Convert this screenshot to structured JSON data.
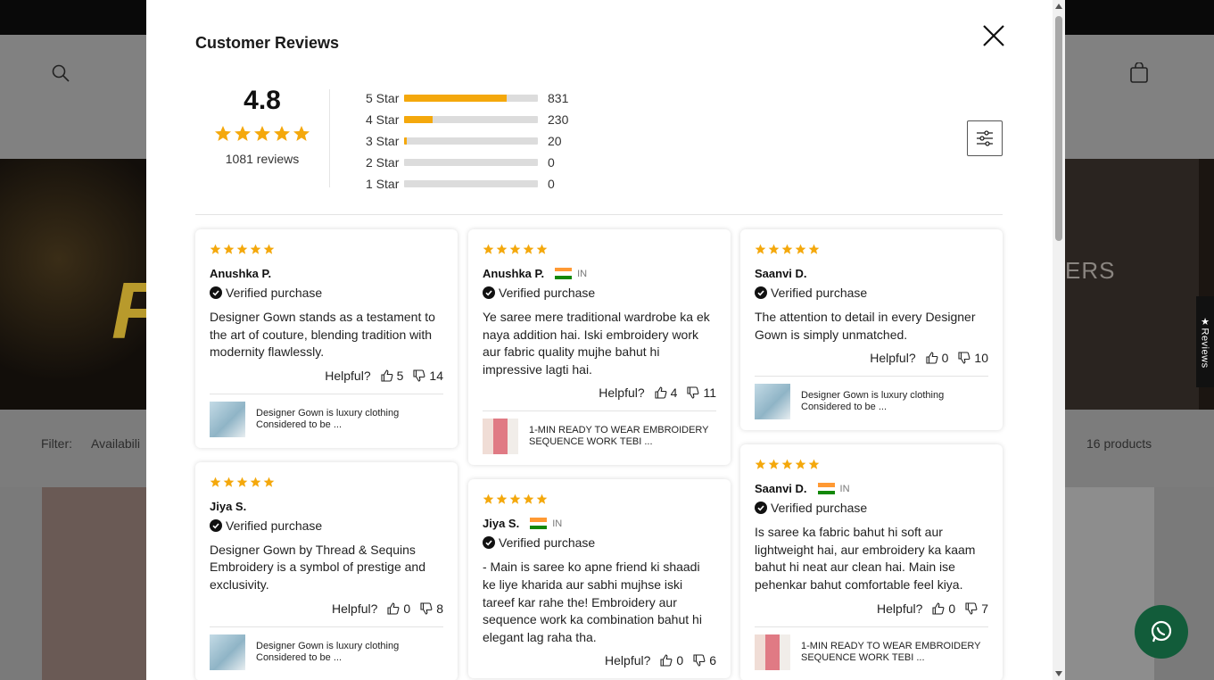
{
  "background": {
    "filter_label": "Filter:",
    "availability_label": "Availabili",
    "products_count": "16 products",
    "side_tab": "★Reviews",
    "hero_text": "ERS",
    "hero_letter": "F"
  },
  "modal": {
    "title": "Customer Reviews",
    "close_icon": "close-icon",
    "filter_icon": "sliders-icon"
  },
  "summary": {
    "average": "4.8",
    "stars": 5,
    "reviews_count": "1081 reviews"
  },
  "distribution": [
    {
      "label": "5 Star",
      "count": "831",
      "fraction": 0.769
    },
    {
      "label": "4 Star",
      "count": "230",
      "fraction": 0.213
    },
    {
      "label": "3 Star",
      "count": "20",
      "fraction": 0.018
    },
    {
      "label": "2 Star",
      "count": "0",
      "fraction": 0
    },
    {
      "label": "1 Star",
      "count": "0",
      "fraction": 0
    }
  ],
  "colors": {
    "star": "#f4a80c",
    "bar_bg": "#dcdcdc"
  },
  "reviews": [
    {
      "name": "Anushka P.",
      "verified": "Verified purchase",
      "text": "Designer Gown stands as a testament to the art of couture, blending tradition with modernity flawlessly.",
      "helpful": "Helpful?",
      "up": "5",
      "down": "14",
      "product": "Designer Gown is luxury clothing Considered to be ..."
    },
    {
      "name": "Jiya S.",
      "verified": "Verified purchase",
      "text": "Designer Gown by Thread & Sequins Embroidery is a symbol of prestige and exclusivity.",
      "helpful": "Helpful?",
      "up": "0",
      "down": "8",
      "product": "Designer Gown is luxury clothing Considered to be ..."
    },
    {
      "name": "Anushka P.",
      "country": "IN",
      "verified": "Verified purchase",
      "text": "Ye saree mere traditional wardrobe ka ek naya addition hai. Iski embroidery work aur fabric quality mujhe bahut hi impressive lagti hai.",
      "helpful": "Helpful?",
      "up": "4",
      "down": "11",
      "product": "1-MIN READY TO WEAR EMBROIDERY SEQUENCE WORK TEBI ..."
    },
    {
      "name": "Jiya S.",
      "country": "IN",
      "verified": "Verified purchase",
      "text": "- Main is saree ko apne friend ki shaadi ke liye kharida aur sabhi mujhse iski tareef kar rahe the! Embroidery aur sequence work ka combination bahut hi elegant lag raha tha.",
      "helpful": "Helpful?",
      "up": "0",
      "down": "6"
    },
    {
      "name": "Saanvi D.",
      "verified": "Verified purchase",
      "text": "The attention to detail in every Designer Gown is simply unmatched.",
      "helpful": "Helpful?",
      "up": "0",
      "down": "10",
      "product": "Designer Gown is luxury clothing Considered to be ..."
    },
    {
      "name": "Saanvi D.",
      "country": "IN",
      "verified": "Verified purchase",
      "text": "Is saree ka fabric bahut hi soft aur lightweight hai, aur embroidery ka kaam bahut hi neat aur clean hai. Main ise pehenkar bahut comfortable feel kiya.",
      "helpful": "Helpful?",
      "up": "0",
      "down": "7",
      "product": "1-MIN READY TO WEAR EMBROIDERY SEQUENCE WORK TEBI ..."
    }
  ]
}
